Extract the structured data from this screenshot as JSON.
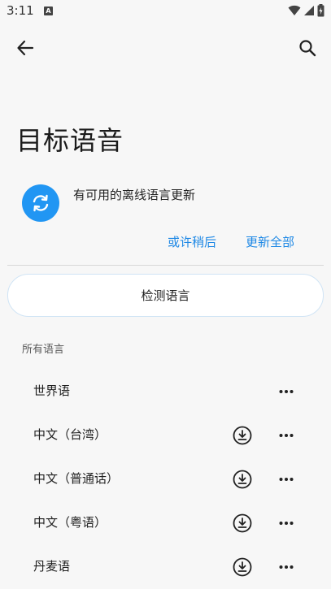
{
  "status_bar": {
    "time": "3:11",
    "notification_badge": "A"
  },
  "toolbar": {
    "back_icon": "arrow-left-icon",
    "search_icon": "search-icon"
  },
  "page": {
    "title": "目标语音"
  },
  "update_card": {
    "icon": "sync-icon",
    "message": "有可用的离线语言更新",
    "later_label": "或许稍后",
    "update_all_label": "更新全部"
  },
  "detect_button": {
    "label": "检测语言"
  },
  "all_languages": {
    "header": "所有语言",
    "items": [
      {
        "label": "世界语",
        "downloadable": false
      },
      {
        "label": "中文（台湾）",
        "downloadable": true
      },
      {
        "label": "中文（普通话）",
        "downloadable": true
      },
      {
        "label": "中文（粤语）",
        "downloadable": true
      },
      {
        "label": "丹麦语",
        "downloadable": true
      }
    ]
  },
  "colors": {
    "accent": "#1e88e5",
    "icon_bg": "#2196f3",
    "background": "#f7f7f7"
  }
}
